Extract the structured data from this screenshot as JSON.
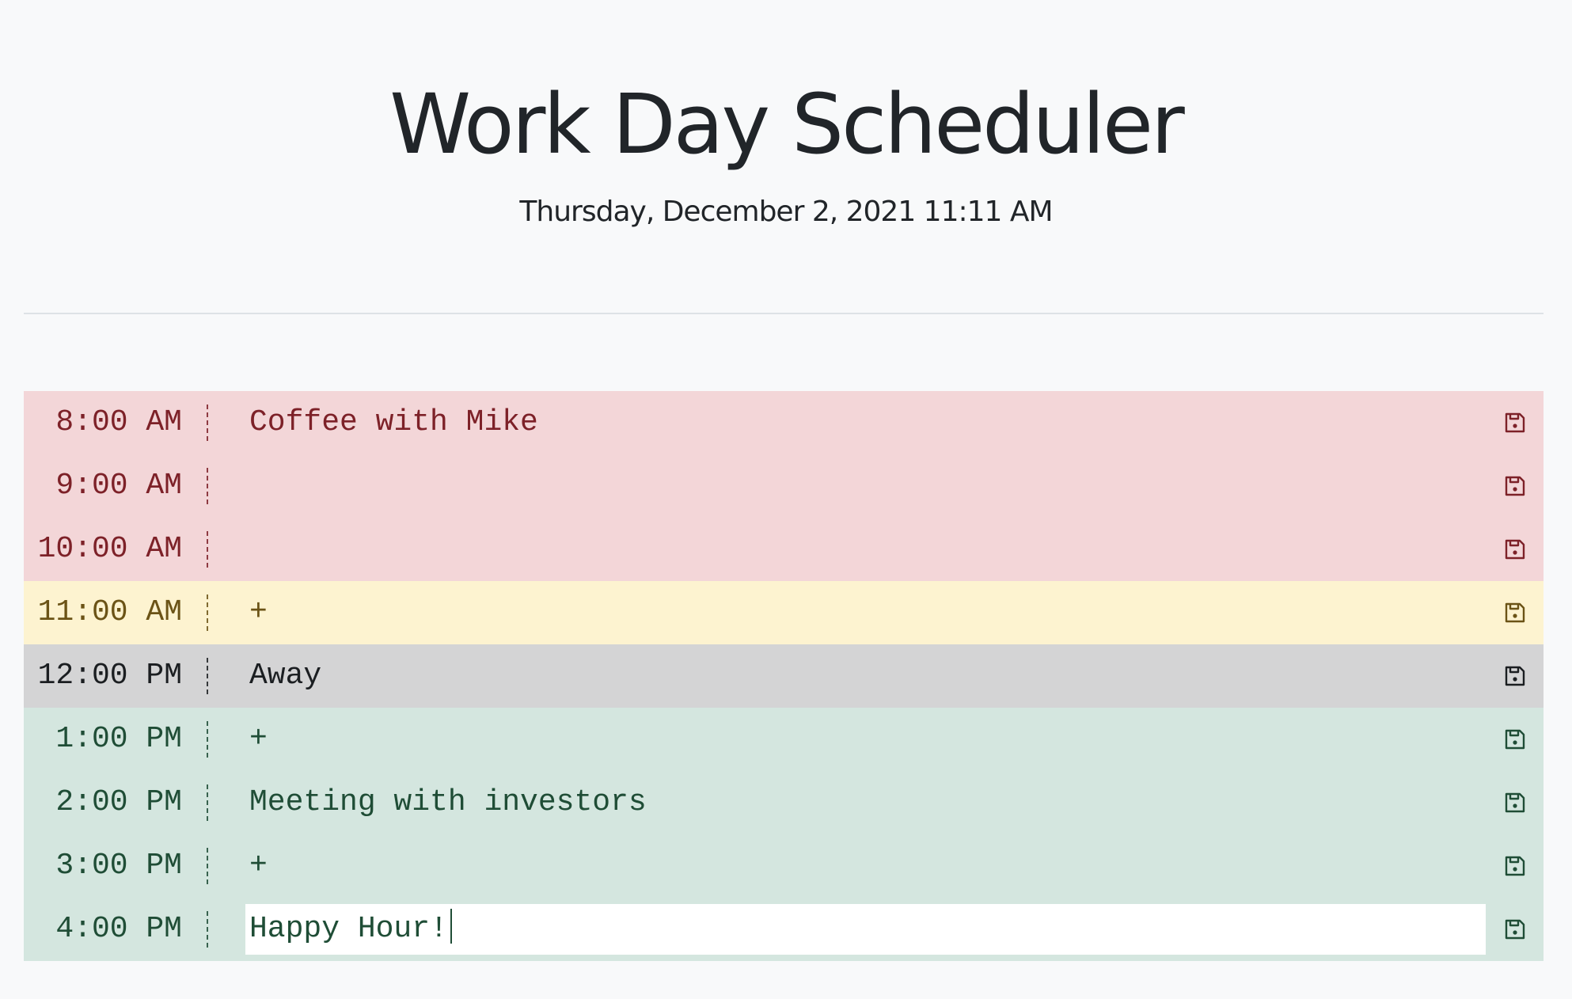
{
  "header": {
    "title": "Work Day Scheduler",
    "date": "Thursday, December 2, 2021 11:11 AM"
  },
  "colors": {
    "past": "#f3d6d8",
    "present": "#fdf3d0",
    "away": "#d4d4d5",
    "future": "#d4e6df"
  },
  "icons": {
    "save": "floppy-disk-icon"
  },
  "schedule": {
    "rows": [
      {
        "hour": "8:00 AM",
        "text": "Coffee with Mike",
        "state": "past"
      },
      {
        "hour": "9:00 AM",
        "text": "",
        "state": "past"
      },
      {
        "hour": "10:00 AM",
        "text": "",
        "state": "past"
      },
      {
        "hour": "11:00 AM",
        "text": "+",
        "state": "present"
      },
      {
        "hour": "12:00 PM",
        "text": "Away",
        "state": "away"
      },
      {
        "hour": "1:00 PM",
        "text": "+",
        "state": "future"
      },
      {
        "hour": "2:00 PM",
        "text": "Meeting with investors",
        "state": "future"
      },
      {
        "hour": "3:00 PM",
        "text": "+",
        "state": "future"
      },
      {
        "hour": "4:00 PM",
        "text": "Happy Hour!",
        "state": "future",
        "editing": true
      }
    ]
  }
}
